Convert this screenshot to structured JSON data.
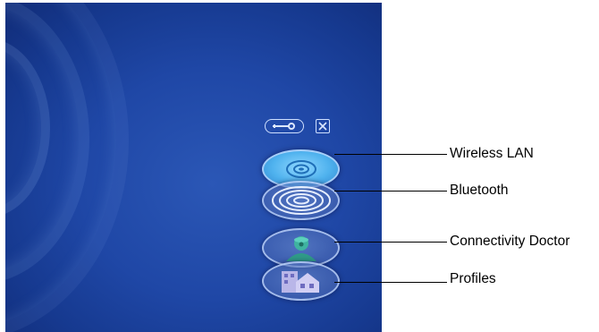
{
  "toolbar": {
    "settings_icon": "wrench-icon",
    "close_icon": "close-icon"
  },
  "buttons": [
    {
      "id": "wireless-lan",
      "label": "Wireless LAN",
      "icon": "disc-icon",
      "state": "active",
      "color": "#4fb2ee"
    },
    {
      "id": "bluetooth",
      "label": "Bluetooth",
      "icon": "concentric-rings-icon",
      "state": "inactive"
    },
    {
      "id": "connectivity-doctor",
      "label": "Connectivity Doctor",
      "icon": "doctor-icon",
      "state": "inactive"
    },
    {
      "id": "profiles",
      "label": "Profiles",
      "icon": "buildings-icon",
      "state": "inactive"
    }
  ],
  "colors": {
    "background": "#1f47a6",
    "ring_highlight": "#cfe0ff"
  }
}
